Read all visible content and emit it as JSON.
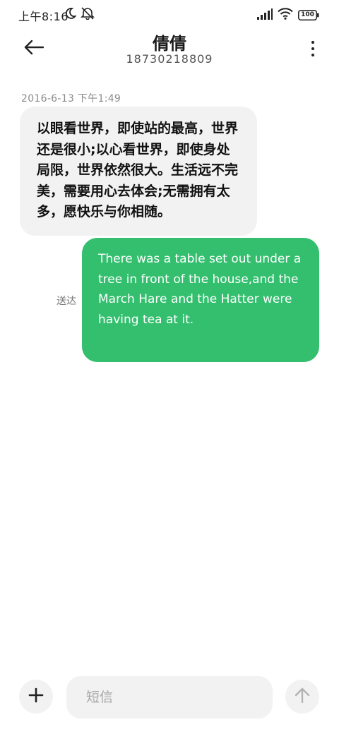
{
  "status_bar": {
    "time": "上午8:16",
    "icons": [
      "moon-icon",
      "mute-icon",
      "signal-icon",
      "wifi-icon",
      "battery-icon"
    ],
    "battery": "100"
  },
  "header": {
    "contact_name": "倩倩",
    "contact_number": "18730218809",
    "back_icon": "arrow-left-icon",
    "more_icon": "more-vertical-icon"
  },
  "conversation": {
    "timestamp": "2016-6-13 下午1:49",
    "incoming": {
      "text": "以眼看世界，即使站的最高，世界还是很小;以心看世界，即使身处局限，世界依然很大。生活远不完美，需要用心去体会;无需拥有太多，愿快乐与你相随。"
    },
    "outgoing": {
      "text": "There was a table set out under a tree in front of the house,and the March Hare and the Hatter were having tea at it.",
      "status": "送达"
    }
  },
  "composer": {
    "placeholder": "短信",
    "value": "",
    "add_icon": "plus-icon",
    "send_icon": "arrow-up-icon"
  },
  "colors": {
    "outgoing_bubble": "#33bf6e",
    "incoming_bubble": "#f2f2f2",
    "background": "#ffffff"
  }
}
